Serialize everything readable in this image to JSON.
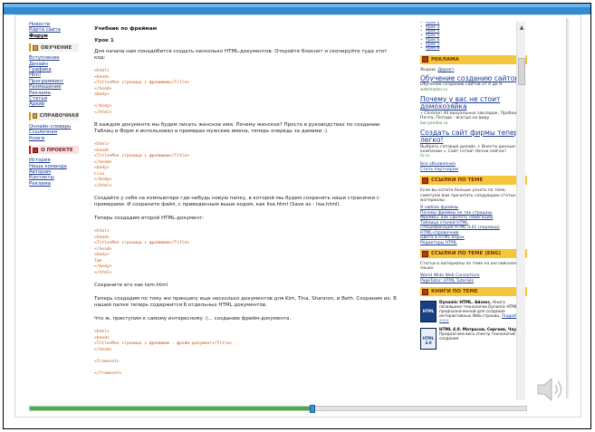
{
  "left": {
    "top_links": [
      "Новости",
      "Карта сайта",
      "Форум"
    ],
    "sections": [
      {
        "title": "ОБУЧЕНИЕ",
        "items": [
          "Вступление",
          "Дизайн",
          "Графика",
          "Html",
          "Программинг",
          "Размещение",
          "Реклама",
          "Статьи",
          "Архив"
        ]
      },
      {
        "title": "СПРАВОЧНАЯ",
        "items": [
          "Онлайн-словарь",
          "Ссылочная",
          "Книги"
        ]
      },
      {
        "title": "О ПРОЕКТЕ",
        "items": [
          "История",
          "Наша команда",
          "Авторам",
          "Контакты",
          "Реклама"
        ]
      }
    ]
  },
  "main": {
    "title": "Учебник по фреймам",
    "lesson": "Урок 1",
    "intro": "Для начала нам понадобится создать несколько HTML-документов. Откройте блокнот и скопируйте туда этот код:",
    "code1": [
      "<html>",
      "<head>",
      "<Title>Моя страница с фреймами</Title>",
      "</head>",
      "<body>",
      "",
      "</body>",
      "</html>"
    ],
    "para2": "В каждом документе мы будем писать женское имя. Почему женское? Просто в руководствах по созданию Таблиц и Форм я использовал в примерах мужские имена, теперь очередь за дамами :).",
    "code2": [
      "<html>",
      "<head>",
      "<Title>Моя страница с фреймами</Title>",
      "</head>",
      "<body>",
      "Lisa",
      "</body>",
      "</html>"
    ],
    "para3": "Создайте у себя на компьютере где-нибудь новую папку, в которой мы будем сохранять наши странички с примерами. И сохраните файл, с приведенным выше кодом, как lisa.html (Save as - lisa.html).",
    "para4": "Теперь создадим второй HTML-документ:",
    "code3": [
      "<html>",
      "<head>",
      "<Title>Моя страница с фреймами</Title>",
      "</head>",
      "<body>",
      "Tam",
      "</body>",
      "</html>"
    ],
    "para5": "Сохраните его как tam.html",
    "para6": "Теперь создадим по тому же принципу еще несколько документов для Kim, Tina, Shannon, и Beth. Сохраним их. В нашей папке теперь содержится 6 отдельных HTML документов.",
    "para7": "Что ж, приступим к самому интересному :)... созданию фрейм-документа.",
    "code4": [
      "<html>",
      "<head>",
      "<Title>Моя страница с фреймами - фрейм-документ</Title>",
      "</head>",
      "",
      "<frameset>",
      "",
      "</frameset>"
    ]
  },
  "right": {
    "lessons": [
      "Урок 2",
      "Урок 3",
      "Урок 4",
      "Урок 5",
      "Урок 6",
      "Урок 7",
      "Урок 8"
    ],
    "ads_head": "РЕКЛАМА",
    "ads_label": "Яндекс",
    "ads_label_link": "Директ",
    "ads": [
      {
        "title": "Обучение созданию сайтов",
        "text": "Обучение созданию сайтов от А до Я.",
        "url": "webmaster.ru"
      },
      {
        "title": "Почему у вас не стоит домохозяйка",
        "text": "« Chrome! 40 визуальных закладок, Пробки, Почта, Погода - всегда на виду",
        "url": "bar.yandex.ru"
      },
      {
        "title": "Создать сайт фирмы теперь легко!",
        "text": "Выбрать готовый дизайн + Внести данные компании = Сайт готов! Начни сейчас!",
        "url": "fo.ru"
      }
    ],
    "ads_links": [
      "Все объявления",
      "Стать партнером"
    ],
    "links_head": "ССЫЛКИ ПО ТЕМЕ",
    "links_note": "Если вы хотите больше узнать по теме, советуем вам прочитать следующие статьи и материалы:",
    "links": [
      "Я люблю фреймы",
      "Почему фреймы не так страшны",
      "Фреймы: как сделать навигацию",
      "Таблица стилей HTML",
      "Спецификация HTML 4.01 (перевод)",
      "HTML-справочник",
      "Цвета в HTML кодах",
      "Редакторы HTML"
    ],
    "links_en_head": "ССЫЛКИ ПО ТЕМЕ (ENG)",
    "links_en_note": "Статьи и материалы по теме на английском языке.",
    "links_en": [
      "World Wide Web Consortium",
      "PageTutor: HTML Tutorials"
    ],
    "books_head": "КНИГИ ПО ТЕМЕ",
    "books": [
      {
        "cover": "HTML",
        "title": "Dynamic HTML. Айзекс.",
        "text": "Книга посвящена технологии Dynamic HTML, предназначенной для создания интерактивных Web-страниц.",
        "more": "Подробнее >>>"
      },
      {
        "cover": "HTML 4.0",
        "title": "HTML 4.0. Матросов, Сергеев, Чаунин.",
        "text": "Предлагаем весь спектр технологий создания",
        "more": ""
      }
    ]
  },
  "colors": {
    "accent": "#2f8bd3",
    "progress": "#46b048",
    "link": "#1a3a8c",
    "code": "#c85a12"
  },
  "progress": {
    "value": 0.57
  },
  "icons": {
    "speaker": "speaker-icon",
    "scroll_up": "chevron-up-icon"
  }
}
